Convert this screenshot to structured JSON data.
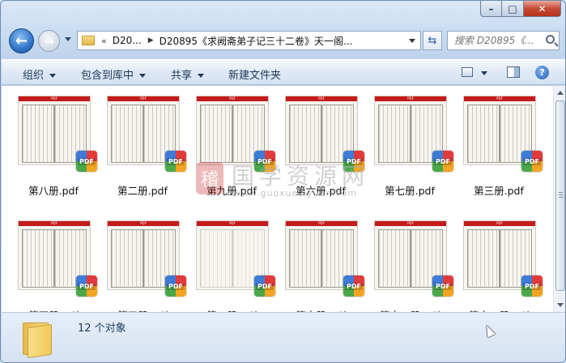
{
  "window": {
    "minimize_glyph": "–",
    "maximize_glyph": "□",
    "close_glyph": "✕"
  },
  "nav": {
    "back_glyph": "←",
    "forward_glyph": "→"
  },
  "address": {
    "chevrons": "«",
    "segments": [
      "D20...",
      "D20895《求阙斋弟子记三十二卷》天一阁..."
    ],
    "separator_glyph": "▶"
  },
  "refresh_glyph": "⇆",
  "search": {
    "placeholder": "搜索 D20895《..."
  },
  "toolbar": {
    "organize": "组织",
    "include_in_library": "包含到库中",
    "share": "共享",
    "new_folder": "新建文件夹",
    "help_glyph": "?"
  },
  "files": [
    {
      "name": "第八册.pdf"
    },
    {
      "name": "第二册.pdf"
    },
    {
      "name": "第九册.pdf"
    },
    {
      "name": "第六册.pdf"
    },
    {
      "name": "第七册.pdf"
    },
    {
      "name": "第三册.pdf"
    },
    {
      "name": "第四册.pdf"
    },
    {
      "name": "第五册.pdf"
    },
    {
      "name": "第一册.pdf"
    },
    {
      "name": "第十册.pdf"
    },
    {
      "name": "第十二册.pdf"
    },
    {
      "name": "第十一册.pdf"
    }
  ],
  "pdf_badge_label": "PDF",
  "thumb_band_label": "PDF",
  "watermark": {
    "logo_char": "稽",
    "title": "国学资源网",
    "url": "www.guoxueziyuan.com"
  },
  "status": {
    "item_count": "12 个对象"
  }
}
